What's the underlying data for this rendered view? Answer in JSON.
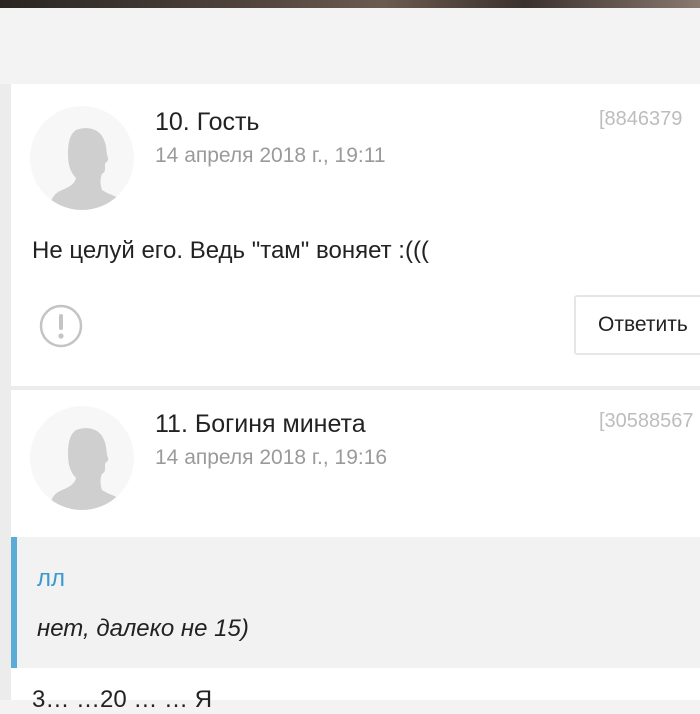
{
  "comments": [
    {
      "author": "10. Гость",
      "date": "14 апреля 2018 г., 19:11",
      "id_label": "[8846379",
      "text": "Не целуй его. Ведь \"там\" воняет :(((",
      "reply_label": "Ответить",
      "report_icon": "exclamation-circle-icon",
      "avatar_icon": "default-user-silhouette-icon"
    },
    {
      "author": "11. Богиня минета",
      "date": "14 апреля 2018 г., 19:16",
      "id_label": "[30588567",
      "avatar_icon": "default-user-silhouette-icon",
      "quote": {
        "author": "лл",
        "text": "нет, далеко не 15)"
      },
      "text_partial": "3… …20 … … Я"
    }
  ],
  "colors": {
    "page_bg": "#f3f3f3",
    "card_bg": "#ffffff",
    "quote_accent": "#5aabd6",
    "quote_author": "#3a9ad1",
    "meta_gray": "#9a9a9a",
    "id_gray": "#bdbdbd"
  }
}
